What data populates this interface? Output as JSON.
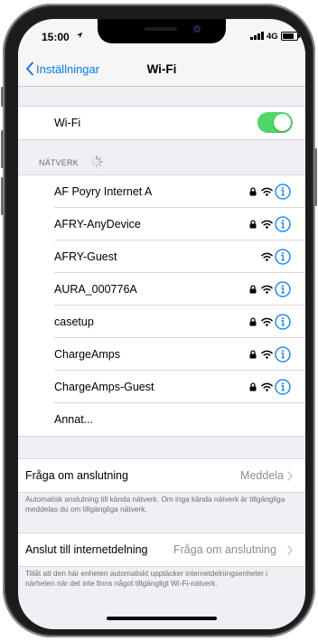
{
  "status_bar": {
    "time": "15:00",
    "network": "4G"
  },
  "nav": {
    "back_label": "Inställningar",
    "title": "Wi-Fi"
  },
  "wifi_toggle": {
    "label": "Wi-Fi",
    "on": true
  },
  "networks": {
    "header": "NÄTVERK",
    "items": [
      {
        "name": "AF Poyry Internet A",
        "secured": true
      },
      {
        "name": "AFRY-AnyDevice",
        "secured": true
      },
      {
        "name": "AFRY-Guest",
        "secured": false
      },
      {
        "name": "AURA_000776A",
        "secured": true
      },
      {
        "name": "casetup",
        "secured": true
      },
      {
        "name": "ChargeAmps",
        "secured": true
      },
      {
        "name": "ChargeAmps-Guest",
        "secured": true
      }
    ],
    "other_label": "Annat..."
  },
  "ask_to_join": {
    "label": "Fråga om anslutning",
    "value": "Meddela",
    "footnote": "Automatisk anslutning till kända nätverk. Om inga kända nätverk är tillgängliga meddelas du om tillgängliga nätverk."
  },
  "hotspot": {
    "label": "Anslut till internetdelning",
    "value": "Fråga om anslutning",
    "footnote": "Tillåt att den här enheten automatiskt upptäcker internetdelningsenheter i närheten när det inte finns något tillgängligt Wi-Fi-nätverk."
  },
  "colors": {
    "accent": "#007aff",
    "toggle_on": "#4cd964",
    "background": "#efeff4"
  }
}
